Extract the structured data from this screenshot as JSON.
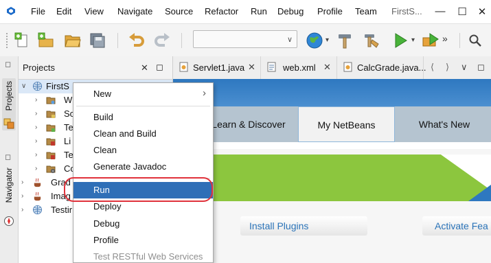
{
  "menubar": {
    "items": [
      "File",
      "Edit",
      "View",
      "Navigate",
      "Source",
      "Refactor",
      "Run",
      "Debug",
      "Profile",
      "Team",
      "FirstS..."
    ],
    "window_controls": {
      "minimize": "—",
      "maximize": "☐",
      "close": "✕"
    }
  },
  "toolbar": {
    "overflow": "»",
    "config_value": "",
    "dropdown_arrow": "▾"
  },
  "sidebar": {
    "projects_label": "Projects",
    "navigator_label": "Navigator"
  },
  "projects_panel": {
    "title": "Projects",
    "close": "✕",
    "restore": "◻",
    "tree": [
      {
        "label": "FirstS",
        "icon": "web-project-icon",
        "expanded": true
      },
      {
        "label": "W",
        "icon": "folder-icon"
      },
      {
        "label": "So",
        "icon": "folder-icon"
      },
      {
        "label": "Te",
        "icon": "folder-icon"
      },
      {
        "label": "Li",
        "icon": "library-icon"
      },
      {
        "label": "Te",
        "icon": "library-icon"
      },
      {
        "label": "Co",
        "icon": "config-icon"
      },
      {
        "label": "Grad",
        "icon": "java-project-icon"
      },
      {
        "label": "Imag",
        "icon": "java-project-icon"
      },
      {
        "label": "Testir",
        "icon": "web-project-icon"
      }
    ]
  },
  "editor_tabs": {
    "tabs": [
      {
        "label": "Servlet1.java",
        "close": "✕"
      },
      {
        "label": "web.xml",
        "close": "✕"
      },
      {
        "label": "CalcGrade.java...",
        "close": ""
      }
    ],
    "nav": [
      "⟨",
      "⟩",
      "∨",
      "◻"
    ]
  },
  "start_page": {
    "tabs": [
      "Learn & Discover",
      "My NetBeans",
      "What's New"
    ],
    "links": [
      "Install Plugins",
      "Activate Fea"
    ]
  },
  "context_menu": {
    "items": [
      {
        "label": "New",
        "submenu": "›"
      },
      {
        "label": "Build"
      },
      {
        "label": "Clean and Build"
      },
      {
        "label": "Clean"
      },
      {
        "label": "Generate Javadoc"
      },
      {
        "label": "Run",
        "active": true
      },
      {
        "label": "Deploy"
      },
      {
        "label": "Debug"
      },
      {
        "label": "Profile"
      },
      {
        "label": "Test RESTful Web Services",
        "disabled": true
      }
    ]
  },
  "colors": {
    "selection": "#2f6fb7",
    "highlight_ring": "#e0313a",
    "start_page_blue": "#2e78c0",
    "start_page_green": "#8cc63e"
  }
}
